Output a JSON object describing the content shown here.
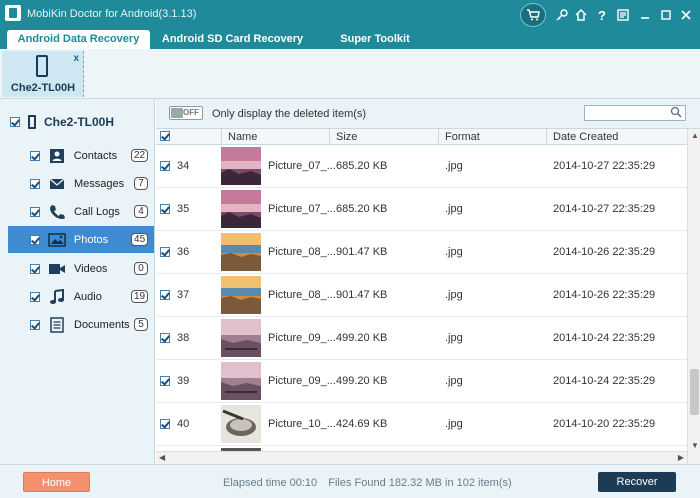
{
  "app": {
    "title": "MobiKin Doctor for Android(3.1.13)"
  },
  "title_icons": [
    "cart-icon",
    "key-icon",
    "home-icon",
    "help-icon",
    "feedback-icon",
    "minimize-icon",
    "maximize-icon",
    "close-icon"
  ],
  "tabs": [
    {
      "label": "Android Data Recovery",
      "active": true
    },
    {
      "label": "Android SD Card Recovery",
      "active": false
    },
    {
      "label": "Super Toolkit",
      "active": false
    }
  ],
  "device": {
    "name": "Che2-TL00H",
    "close": "x"
  },
  "sidebar": {
    "root": "Che2-TL00H",
    "items": [
      {
        "label": "Contacts",
        "count": "22",
        "icon": "contacts-icon"
      },
      {
        "label": "Messages",
        "count": "7",
        "icon": "messages-icon"
      },
      {
        "label": "Call Logs",
        "count": "4",
        "icon": "call-logs-icon"
      },
      {
        "label": "Photos",
        "count": "45",
        "icon": "photos-icon",
        "active": true
      },
      {
        "label": "Videos",
        "count": "0",
        "icon": "videos-icon"
      },
      {
        "label": "Audio",
        "count": "19",
        "icon": "audio-icon"
      },
      {
        "label": "Documents",
        "count": "5",
        "icon": "documents-icon"
      }
    ]
  },
  "filter": {
    "toggle_label": "OFF",
    "label": "Only display the deleted item(s)"
  },
  "table": {
    "headers": [
      "Name",
      "Size",
      "Format",
      "Date Created"
    ],
    "rows": [
      {
        "num": "34",
        "name": "Picture_07_...",
        "size": "685.20 KB",
        "format": ".jpg",
        "date": "2014-10-27 22:35:29"
      },
      {
        "num": "35",
        "name": "Picture_07_...",
        "size": "685.20 KB",
        "format": ".jpg",
        "date": "2014-10-27 22:35:29"
      },
      {
        "num": "36",
        "name": "Picture_08_...",
        "size": "901.47 KB",
        "format": ".jpg",
        "date": "2014-10-26 22:35:29"
      },
      {
        "num": "37",
        "name": "Picture_08_...",
        "size": "901.47 KB",
        "format": ".jpg",
        "date": "2014-10-26 22:35:29"
      },
      {
        "num": "38",
        "name": "Picture_09_...",
        "size": "499.20 KB",
        "format": ".jpg",
        "date": "2014-10-24 22:35:29"
      },
      {
        "num": "39",
        "name": "Picture_09_...",
        "size": "499.20 KB",
        "format": ".jpg",
        "date": "2014-10-24 22:35:29"
      },
      {
        "num": "40",
        "name": "Picture_10_...",
        "size": "424.69 KB",
        "format": ".jpg",
        "date": "2014-10-20 22:35:29"
      }
    ]
  },
  "footer": {
    "home_label": "Home",
    "elapsed": "Elapsed time 00:10",
    "files_found": "Files Found 182.32 MB in 102 item(s)",
    "recover_label": "Recover"
  },
  "colors": {
    "brand": "#1f8a99",
    "active_item": "#3d8bd0",
    "home_button": "#f3916f",
    "recover_button": "#1c3b55"
  }
}
